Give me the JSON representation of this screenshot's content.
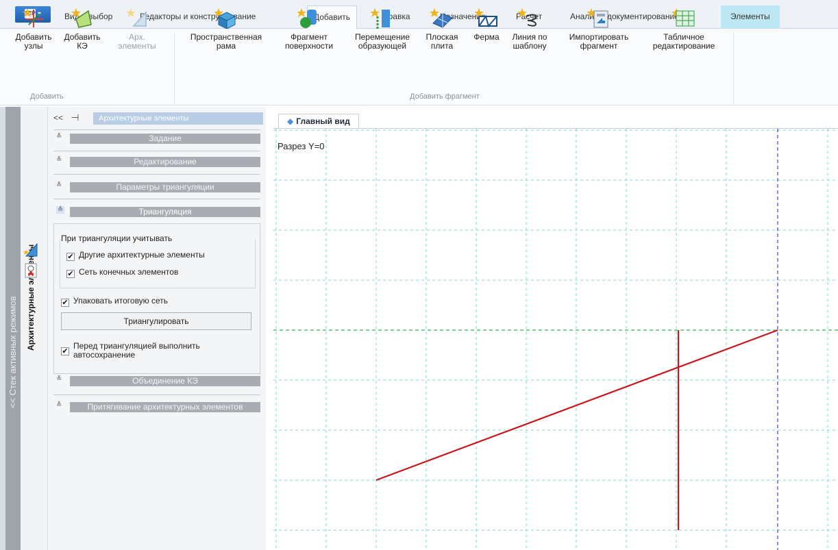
{
  "ribbon_tabs": {
    "app_button": "FEP",
    "items": [
      {
        "label": "Вид и выбор",
        "state": "normal"
      },
      {
        "label": "Редакторы и конструирование",
        "state": "normal"
      },
      {
        "label": "Добавить",
        "state": "active"
      },
      {
        "label": "Правка",
        "state": "normal"
      },
      {
        "label": "Назначение",
        "state": "normal"
      },
      {
        "label": "Расчет",
        "state": "normal"
      },
      {
        "label": "Анализ и документирование",
        "state": "normal"
      },
      {
        "label": "Элементы",
        "state": "context"
      }
    ]
  },
  "ribbon": {
    "add_group": {
      "label": "Добавить",
      "buttons": [
        {
          "line1": "Добавить",
          "line2": "узлы",
          "icon": "add-nodes-icon",
          "enabled": true
        },
        {
          "line1": "Добавить",
          "line2": "КЭ",
          "icon": "add-fe-icon",
          "enabled": true
        },
        {
          "line1": "Арх.",
          "line2": "элементы",
          "icon": "arch-elements-icon",
          "enabled": false
        }
      ]
    },
    "fragment_group": {
      "label": "Добавить фрагмент",
      "buttons": [
        {
          "line1": "Пространственная",
          "line2": "рама",
          "icon": "spatial-frame-icon"
        },
        {
          "line1": "Фрагмент",
          "line2": "поверхности",
          "icon": "surface-fragment-icon"
        },
        {
          "line1": "Перемещение",
          "line2": "образующей",
          "icon": "generatrix-move-icon"
        },
        {
          "line1": "Плоская",
          "line2": "плита",
          "icon": "flat-plate-icon"
        },
        {
          "line1": "Ферма",
          "line2": "",
          "icon": "truss-icon"
        },
        {
          "line1": "Линия по",
          "line2": "шаблону",
          "icon": "template-line-icon"
        },
        {
          "line1": "Импортировать",
          "line2": "фрагмент",
          "icon": "import-fragment-icon"
        },
        {
          "line1": "Табличное",
          "line2": "редактирование",
          "icon": "table-edit-icon"
        }
      ]
    }
  },
  "side_strips": {
    "mode_stack": "<< Стек активных режимов",
    "arch_elements": "Архитектурные элементы"
  },
  "panel": {
    "nav": "<<",
    "pin": "⊣",
    "title": "Архитектурные элементы",
    "sections": {
      "task": "Задание",
      "edit": "Редактирование",
      "tri_params": "Параметры триангуляции",
      "triangulation": "Триангуляция",
      "merge": "Объединение КЭ",
      "snap": "Притягивание архитектурных элементов"
    },
    "triangulation": {
      "legend": "При триангуляции учитывать",
      "other_arch": {
        "label": "Другие архитектурные элементы",
        "checked": true
      },
      "fe_mesh": {
        "label": "Сеть конечных элементов",
        "checked": true
      },
      "pack_mesh": {
        "label": "Упаковать итоговую сеть",
        "checked": true
      },
      "button": "Триангулировать",
      "autosave_line1": "Перед триангуляцией выполнить",
      "autosave_line2": "автосохранение",
      "autosave_checked": true
    }
  },
  "viewport": {
    "tab": "Главный вид",
    "section_label": "Разрез Y=0",
    "colors": {
      "grid": "#7fd6cf",
      "axis_h": "#2fb84a",
      "axis_v": "#3d3ddb",
      "member": "#c8161d"
    }
  }
}
